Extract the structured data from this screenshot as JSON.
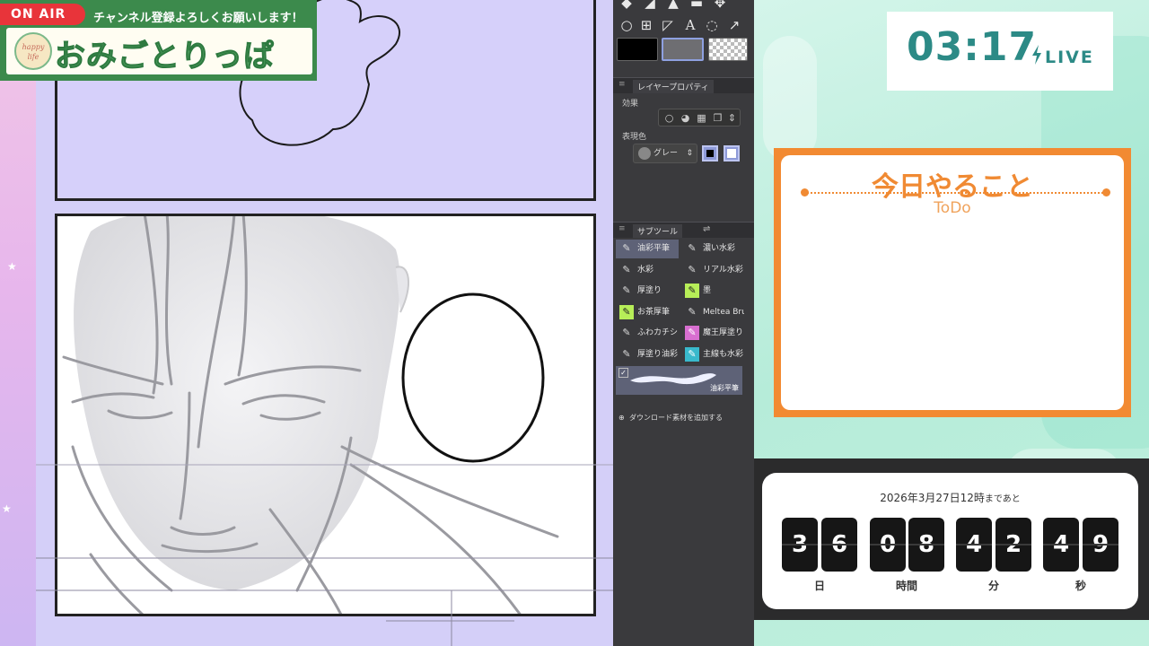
{
  "banner": {
    "on_air": "ON AIR",
    "subscribe": "チャンネル登録よろしくお願いします！",
    "logo_text": "happy life",
    "channel_name": "おみごとりっぱ"
  },
  "tool_panel": {
    "tools_row1": [
      "fill-bucket-icon",
      "eraser-icon",
      "fill-icon",
      "gradient-icon",
      "move-icon"
    ],
    "tools_row2": [
      "ellipse-icon",
      "frame-icon",
      "ruler-icon",
      "text-icon",
      "balloon-icon",
      "correct-line-icon"
    ],
    "text_tool_glyph": "A",
    "layer_property": {
      "title": "レイヤープロパティ",
      "effect_label": "効果",
      "expression_label": "表現色",
      "expression_value": "グレー"
    },
    "sub_tool": {
      "title": "サブツール",
      "items": [
        {
          "label": "油彩平筆",
          "active": true
        },
        {
          "label": "濃い水彩",
          "active": false
        },
        {
          "label": "水彩",
          "active": false
        },
        {
          "label": "リアル水彩",
          "active": false
        },
        {
          "label": "厚塗り",
          "active": false
        },
        {
          "label": "墨",
          "active": false
        },
        {
          "label": "お茶厚筆",
          "active": false
        },
        {
          "label": "Meltea Bru",
          "active": false
        },
        {
          "label": "ふわカチシ",
          "active": false
        },
        {
          "label": "魔王厚塗り",
          "active": false
        },
        {
          "label": "厚塗り油彩",
          "active": false
        },
        {
          "label": "主線も水彩",
          "active": false
        }
      ],
      "preview_label": "油彩平筆",
      "add_download": "ダウンロード素材を追加する"
    },
    "colors": {
      "main": "#000000",
      "sub": "#6e6e72"
    }
  },
  "clock": {
    "time": "03:17",
    "live": "LIVE"
  },
  "todo": {
    "title": "今日やること",
    "subtitle": "ToDo"
  },
  "countdown": {
    "date": "2026年3月27日12時",
    "suffix": "まであと",
    "digits": [
      "3",
      "6",
      "0",
      "8",
      "4",
      "2",
      "4",
      "9"
    ],
    "units": [
      "日",
      "時間",
      "分",
      "秒"
    ]
  },
  "colors": {
    "canvas_bg": "#d4cff8",
    "banner_green": "#3c8a4c",
    "on_air_red": "#e8343a",
    "accent_teal": "#2c8a86",
    "todo_orange": "#f28a32"
  }
}
